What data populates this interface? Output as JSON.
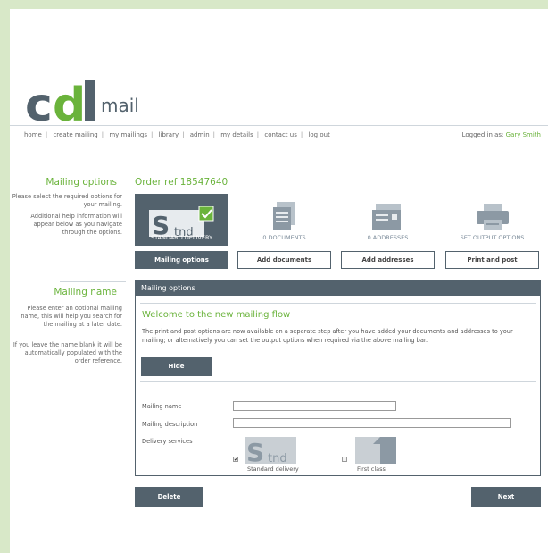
{
  "logo": {
    "main": "cdl",
    "sub": "mail"
  },
  "nav": {
    "items": [
      "home",
      "create mailing",
      "my mailings",
      "library",
      "admin",
      "my details",
      "contact us",
      "log out"
    ],
    "logged_in_label": "Logged in as:",
    "user": "Gary Smith"
  },
  "sidebar": {
    "options_title": "Mailing options",
    "options_text_1": "Please select the required options for your mailing.",
    "options_text_2": "Additional help information will appear below as you navigate through the options.",
    "name_title": "Mailing name",
    "name_text_1": "Please enter an optional mailing name, this will help you search for the mailing at a later date.",
    "name_text_2": "If you leave the name blank it will be automatically populated with the order reference."
  },
  "order_ref": "Order ref 18547640",
  "steps": [
    {
      "caption": "STANDARD DELIVERY",
      "button": "Mailing options",
      "icon": "standard-delivery-icon"
    },
    {
      "caption": "0 DOCUMENTS",
      "button": "Add documents",
      "icon": "document-icon"
    },
    {
      "caption": "0 ADDRESSES",
      "button": "Add addresses",
      "icon": "address-card-icon"
    },
    {
      "caption": "SET OUTPUT OPTIONS",
      "button": "Print and post",
      "icon": "printer-icon"
    }
  ],
  "panel": {
    "title": "Mailing options",
    "welcome": "Welcome to the new mailing flow",
    "welcome_text": "The print and post options are now available on a separate step after you have added your documents and addresses to your mailing; or alternatively you can set the output options when required via the above mailing bar.",
    "hide_label": "Hide",
    "mailing_name_label": "Mailing name",
    "mailing_name_value": "",
    "mailing_desc_label": "Mailing description",
    "mailing_desc_value": "",
    "delivery_label": "Delivery services",
    "services": [
      {
        "label": "Standard delivery",
        "checked": true,
        "icon_text": "Stnd"
      },
      {
        "label": "First class",
        "checked": false,
        "icon_text": "1"
      }
    ]
  },
  "actions": {
    "delete": "Delete",
    "next": "Next"
  },
  "colors": {
    "accent": "#6ab33b",
    "slate": "#53626d"
  }
}
